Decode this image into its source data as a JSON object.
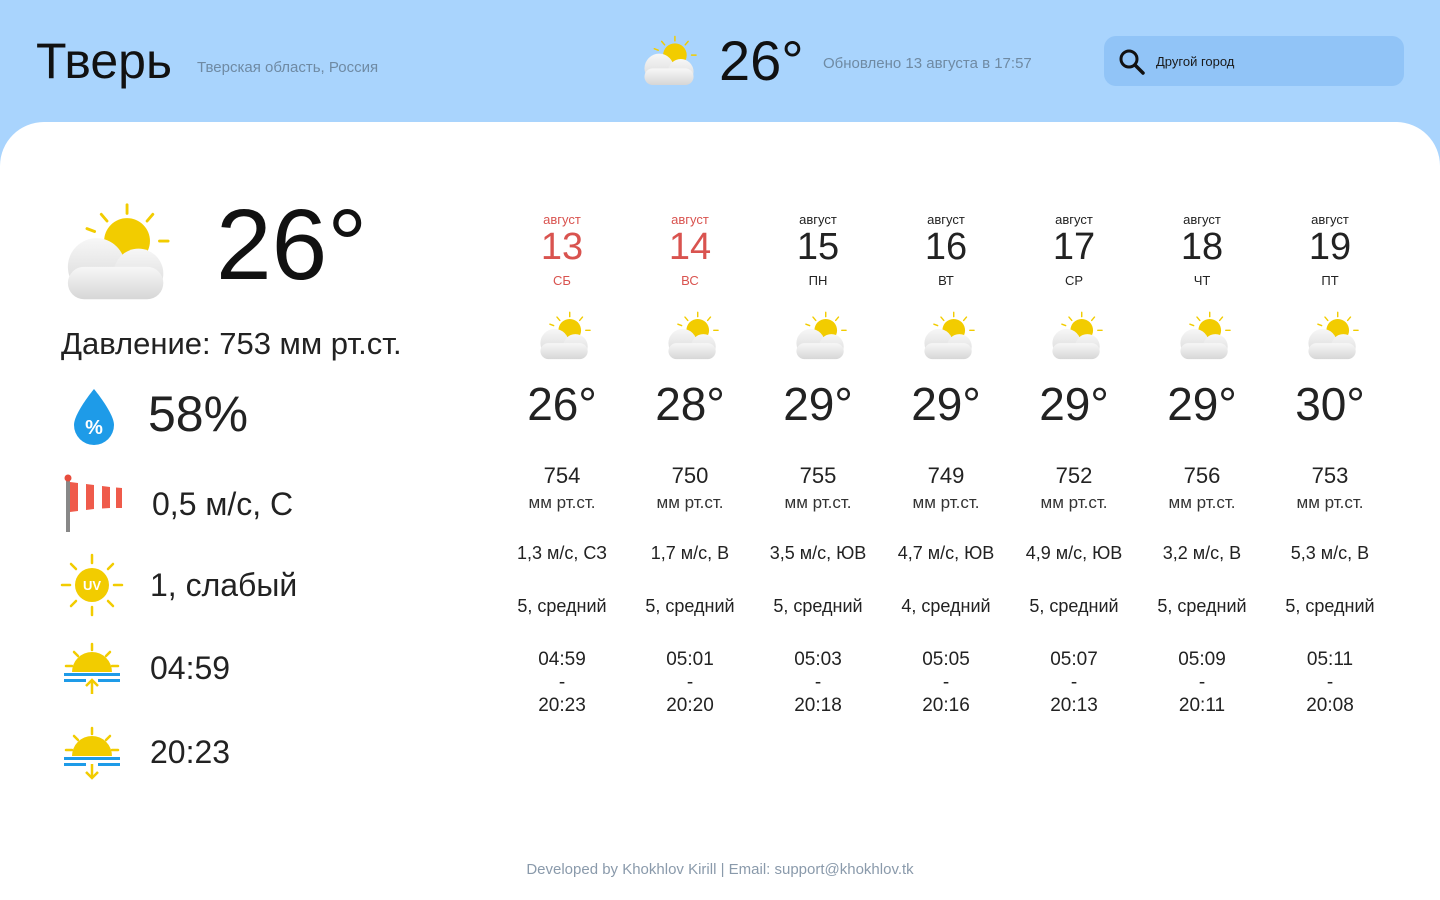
{
  "header": {
    "city": "Тверь",
    "region": "Тверская область, Россия",
    "temp": "26°",
    "updated": "Обновлено 13 августа в 17:57",
    "icon": "partly-cloudy-icon"
  },
  "search": {
    "placeholder": "Другой город",
    "icon": "search-icon"
  },
  "current": {
    "temp": "26°",
    "pressure": "Давление: 753 мм рт.ст.",
    "humidity": "58%",
    "wind": "0,5 м/с, С",
    "uv": "1, слабый",
    "sunrise": "04:59",
    "sunset": "20:23"
  },
  "forecast": [
    {
      "month": "август",
      "day": "13",
      "weekday": "СБ",
      "weekend": true,
      "temp": "26°",
      "pressure": "754",
      "pressure_unit": "мм рт.ст.",
      "wind": "1,3 м/с, СЗ",
      "uv": "5, средний",
      "sunrise": "04:59",
      "dash": "-",
      "sunset": "20:23"
    },
    {
      "month": "август",
      "day": "14",
      "weekday": "ВС",
      "weekend": true,
      "temp": "28°",
      "pressure": "750",
      "pressure_unit": "мм рт.ст.",
      "wind": "1,7 м/с, В",
      "uv": "5, средний",
      "sunrise": "05:01",
      "dash": "-",
      "sunset": "20:20"
    },
    {
      "month": "август",
      "day": "15",
      "weekday": "ПН",
      "weekend": false,
      "temp": "29°",
      "pressure": "755",
      "pressure_unit": "мм рт.ст.",
      "wind": "3,5 м/с, ЮВ",
      "uv": "5, средний",
      "sunrise": "05:03",
      "dash": "-",
      "sunset": "20:18"
    },
    {
      "month": "август",
      "day": "16",
      "weekday": "ВТ",
      "weekend": false,
      "temp": "29°",
      "pressure": "749",
      "pressure_unit": "мм рт.ст.",
      "wind": "4,7 м/с, ЮВ",
      "uv": "4, средний",
      "sunrise": "05:05",
      "dash": "-",
      "sunset": "20:16"
    },
    {
      "month": "август",
      "day": "17",
      "weekday": "СР",
      "weekend": false,
      "temp": "29°",
      "pressure": "752",
      "pressure_unit": "мм рт.ст.",
      "wind": "4,9 м/с, ЮВ",
      "uv": "5, средний",
      "sunrise": "05:07",
      "dash": "-",
      "sunset": "20:13"
    },
    {
      "month": "август",
      "day": "18",
      "weekday": "ЧТ",
      "weekend": false,
      "temp": "29°",
      "pressure": "756",
      "pressure_unit": "мм рт.ст.",
      "wind": "3,2 м/с, В",
      "uv": "5, средний",
      "sunrise": "05:09",
      "dash": "-",
      "sunset": "20:11"
    },
    {
      "month": "август",
      "day": "19",
      "weekday": "ПТ",
      "weekend": false,
      "temp": "30°",
      "pressure": "753",
      "pressure_unit": "мм рт.ст.",
      "wind": "5,3 м/с, В",
      "uv": "5, средний",
      "sunrise": "05:11",
      "dash": "-",
      "sunset": "20:08"
    }
  ],
  "footer": "Developed by Khokhlov Kirill | Email: support@khokhlov.tk",
  "colors": {
    "header_bg": "#a9d4fd",
    "search_bg": "#91c4f7",
    "weekend": "#d9534f",
    "sun": "#f2cc00",
    "drop": "#1e9be8"
  }
}
